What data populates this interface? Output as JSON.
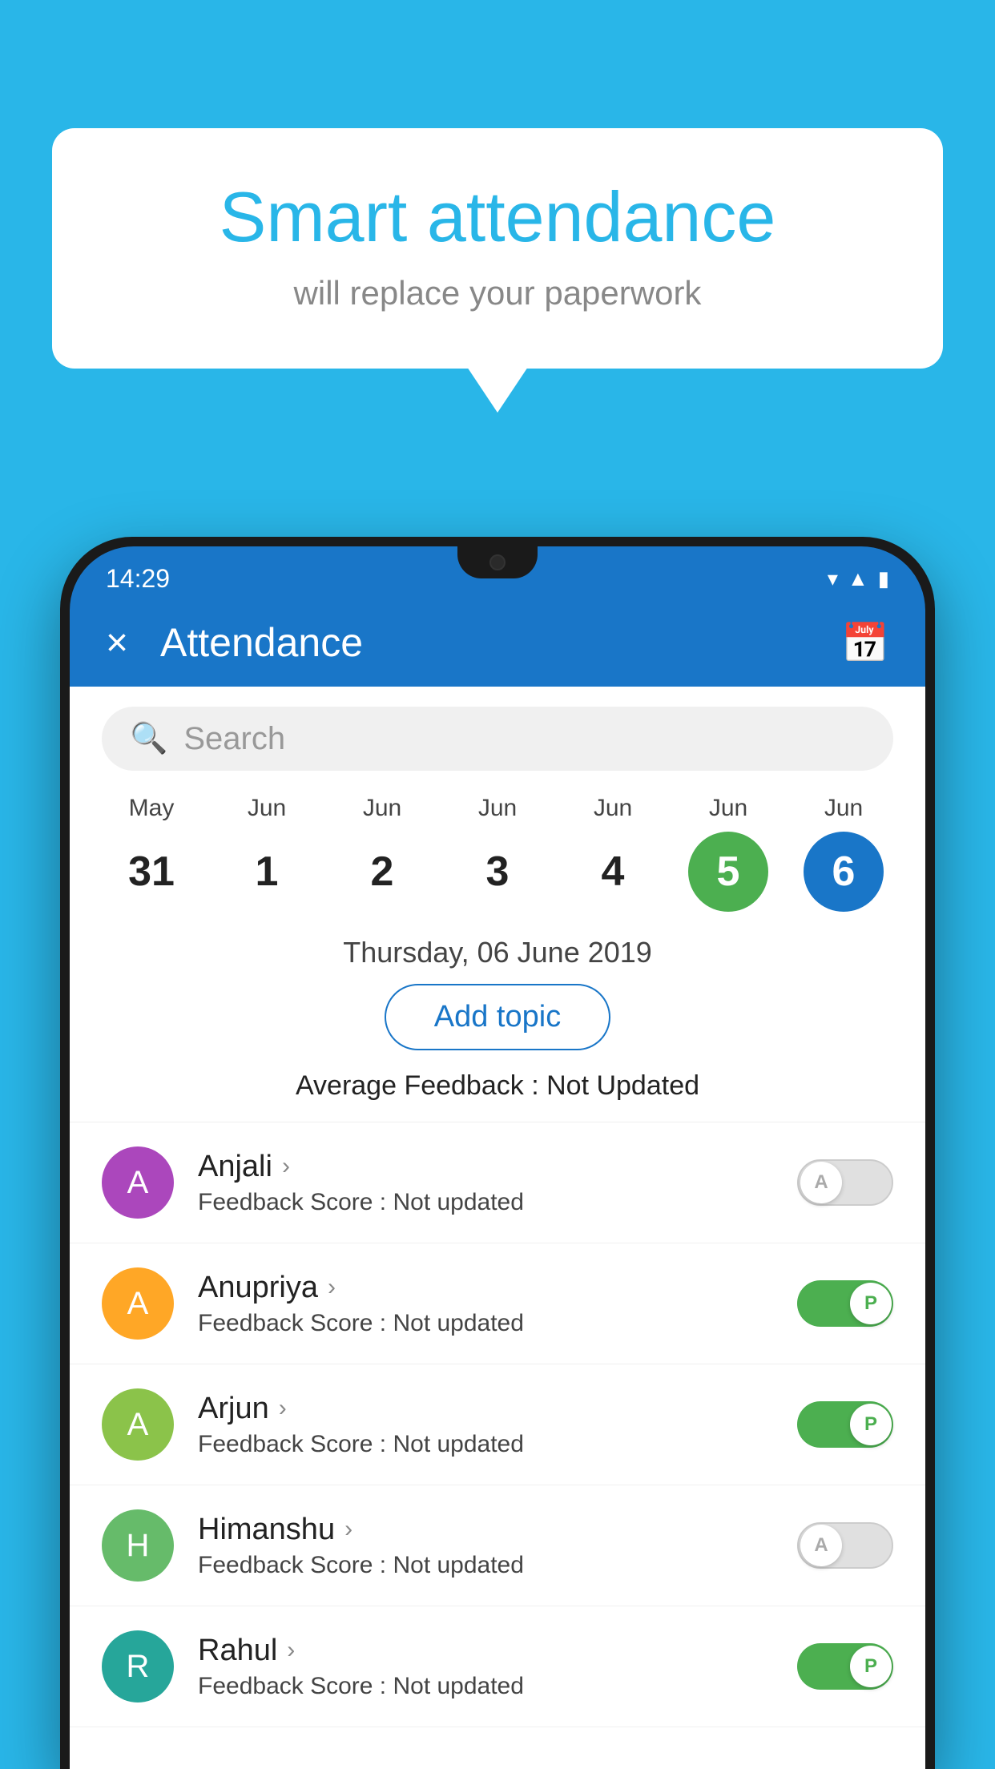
{
  "background_color": "#29b6e8",
  "bubble": {
    "title": "Smart attendance",
    "subtitle": "will replace your paperwork"
  },
  "status_bar": {
    "time": "14:29",
    "icons": [
      "wifi",
      "signal",
      "battery"
    ]
  },
  "app_bar": {
    "title": "Attendance",
    "close_label": "×",
    "calendar_icon": "calendar"
  },
  "search": {
    "placeholder": "Search"
  },
  "calendar": {
    "days": [
      {
        "month": "May",
        "date": "31",
        "state": "normal"
      },
      {
        "month": "Jun",
        "date": "1",
        "state": "normal"
      },
      {
        "month": "Jun",
        "date": "2",
        "state": "normal"
      },
      {
        "month": "Jun",
        "date": "3",
        "state": "normal"
      },
      {
        "month": "Jun",
        "date": "4",
        "state": "normal"
      },
      {
        "month": "Jun",
        "date": "5",
        "state": "today"
      },
      {
        "month": "Jun",
        "date": "6",
        "state": "selected"
      }
    ]
  },
  "selected_date": "Thursday, 06 June 2019",
  "add_topic_label": "Add topic",
  "avg_feedback_label": "Average Feedback :",
  "avg_feedback_value": "Not Updated",
  "students": [
    {
      "name": "Anjali",
      "avatar_letter": "A",
      "avatar_color": "purple",
      "feedback_label": "Feedback Score :",
      "feedback_value": "Not updated",
      "toggle_state": "off",
      "toggle_letter": "A"
    },
    {
      "name": "Anupriya",
      "avatar_letter": "A",
      "avatar_color": "orange",
      "feedback_label": "Feedback Score :",
      "feedback_value": "Not updated",
      "toggle_state": "on",
      "toggle_letter": "P"
    },
    {
      "name": "Arjun",
      "avatar_letter": "A",
      "avatar_color": "green-light",
      "feedback_label": "Feedback Score :",
      "feedback_value": "Not updated",
      "toggle_state": "on",
      "toggle_letter": "P"
    },
    {
      "name": "Himanshu",
      "avatar_letter": "H",
      "avatar_color": "green-dark",
      "feedback_label": "Feedback Score :",
      "feedback_value": "Not updated",
      "toggle_state": "off",
      "toggle_letter": "A"
    },
    {
      "name": "Rahul",
      "avatar_letter": "R",
      "avatar_color": "teal",
      "feedback_label": "Feedback Score :",
      "feedback_value": "Not updated",
      "toggle_state": "on",
      "toggle_letter": "P"
    }
  ]
}
